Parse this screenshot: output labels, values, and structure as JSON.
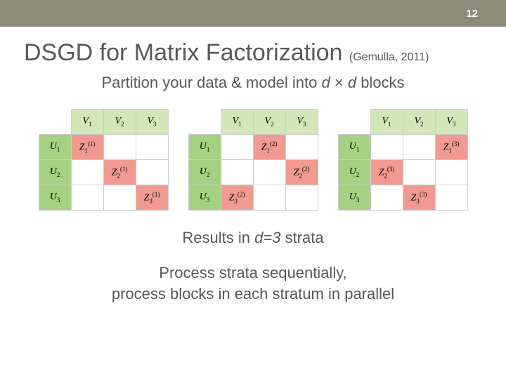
{
  "header": {
    "page_number": "12"
  },
  "title": {
    "main": "DSGD for Matrix Factorization",
    "citation": "(Gemulla, 2011)"
  },
  "subtitle": {
    "prefix": "Partition your data & model into ",
    "var1": "d",
    "times": " × ",
    "var2": "d",
    "suffix": " blocks"
  },
  "results": {
    "prefix": "Results in ",
    "var": "d=3",
    "suffix": " strata"
  },
  "process": {
    "line1": "Process strata sequentially,",
    "line2": "process blocks in each stratum in parallel"
  },
  "chart_data": {
    "type": "table",
    "description": "Three 3x3 block-partition diagrams showing strata of DSGD",
    "column_headers": [
      "V₁",
      "V₂",
      "V₃"
    ],
    "row_headers": [
      "U₁",
      "U₂",
      "U₃"
    ],
    "strata": [
      {
        "superscript": "(1)",
        "highlighted": [
          {
            "row": 0,
            "col": 0,
            "label": "Z₁⁽¹⁾"
          },
          {
            "row": 1,
            "col": 1,
            "label": "Z₂⁽¹⁾"
          },
          {
            "row": 2,
            "col": 2,
            "label": "Z₃⁽¹⁾"
          }
        ]
      },
      {
        "superscript": "(2)",
        "highlighted": [
          {
            "row": 0,
            "col": 1,
            "label": "Z₁⁽²⁾"
          },
          {
            "row": 1,
            "col": 2,
            "label": "Z₂⁽²⁾"
          },
          {
            "row": 2,
            "col": 0,
            "label": "Z₃⁽²⁾"
          }
        ]
      },
      {
        "superscript": "(3)",
        "highlighted": [
          {
            "row": 0,
            "col": 2,
            "label": "Z₁⁽³⁾"
          },
          {
            "row": 1,
            "col": 0,
            "label": "Z₂⁽³⁾"
          },
          {
            "row": 2,
            "col": 1,
            "label": "Z₃⁽³⁾"
          }
        ]
      }
    ]
  },
  "labels": {
    "V1": "V",
    "V1s": "1",
    "V2": "V",
    "V2s": "2",
    "V3": "V",
    "V3s": "3",
    "U1": "U",
    "U1s": "1",
    "U2": "U",
    "U2s": "2",
    "U3": "U",
    "U3s": "3",
    "Z": "Z",
    "s1": "1",
    "s2": "2",
    "s3": "3",
    "p1": "(1)",
    "p2": "(2)",
    "p3": "(3)"
  }
}
